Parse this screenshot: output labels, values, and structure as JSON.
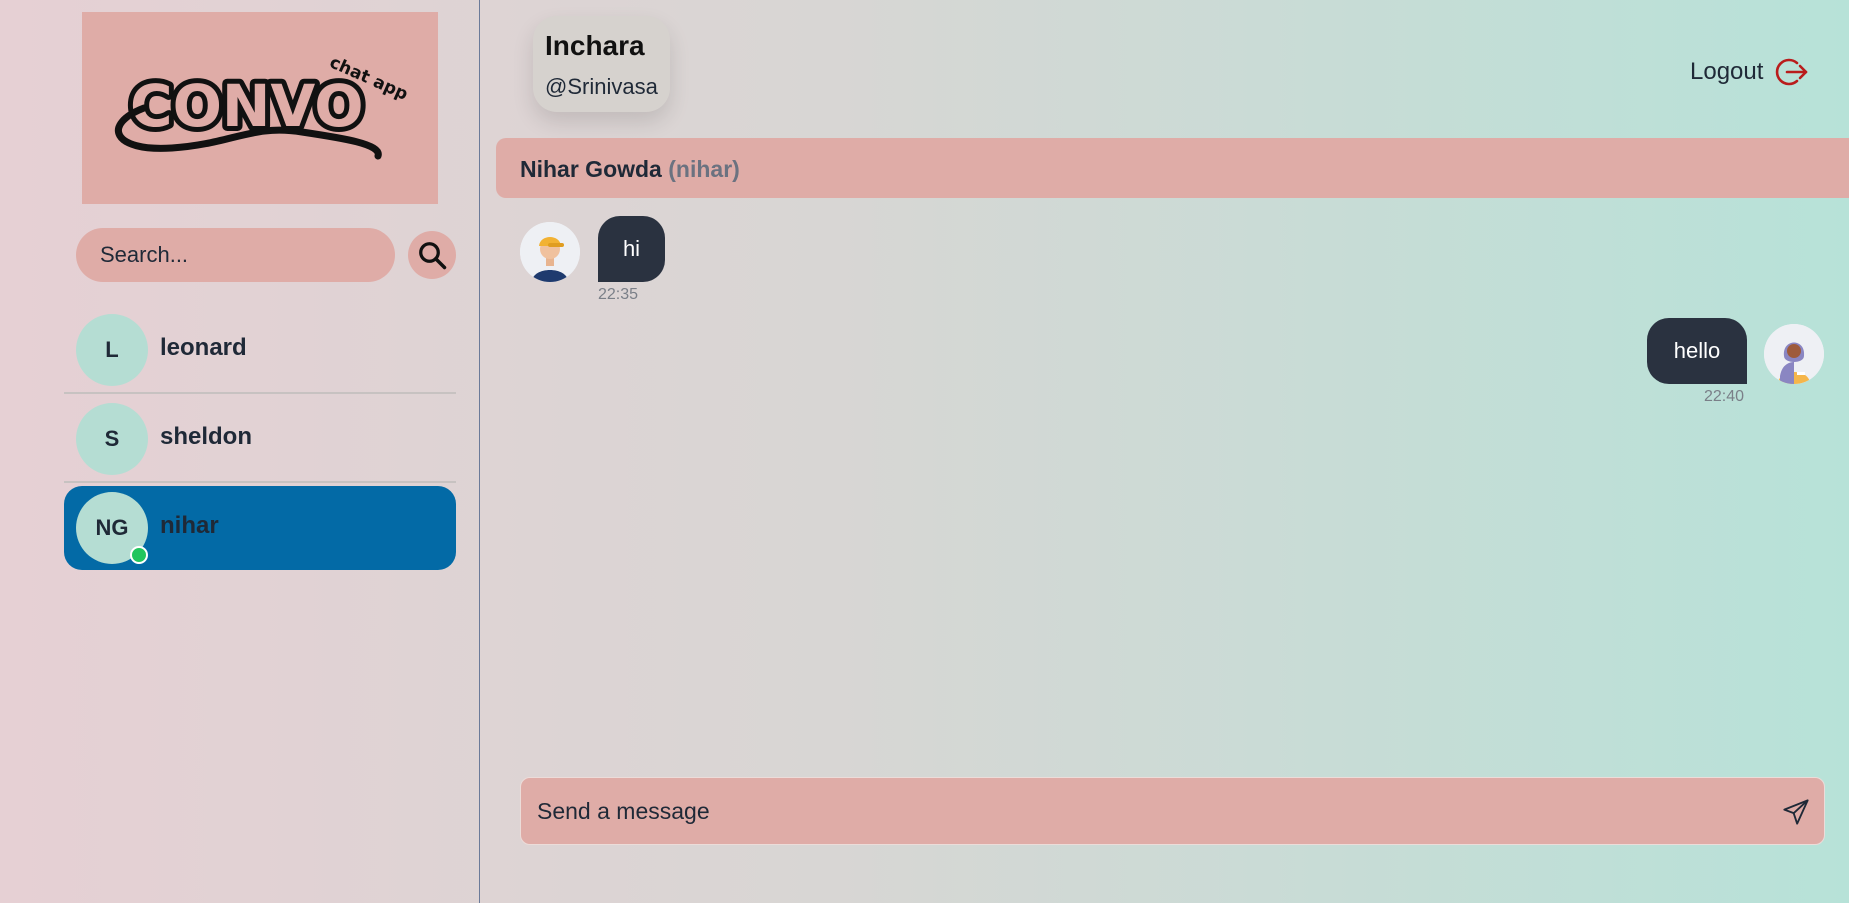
{
  "logo": {
    "wordmark": "CONVO",
    "tagline": "chat app"
  },
  "search": {
    "placeholder": "Search...",
    "button_icon": "search-icon"
  },
  "contacts": [
    {
      "initials": "L",
      "name": "leonard",
      "active": false,
      "online": false
    },
    {
      "initials": "S",
      "name": "sheldon",
      "active": false,
      "online": false
    },
    {
      "initials": "NG",
      "name": "nihar",
      "active": true,
      "online": true
    }
  ],
  "current_user": {
    "name": "Inchara",
    "handle": "@Srinivasa"
  },
  "logout": {
    "label": "Logout",
    "icon": "logout-icon"
  },
  "chat": {
    "header": {
      "full_name": "Nihar Gowda",
      "username": "(nihar)"
    },
    "messages": [
      {
        "text": "hi",
        "time": "22:35",
        "from": "other"
      },
      {
        "text": "hello",
        "time": "22:40",
        "from": "me"
      }
    ]
  },
  "composer": {
    "placeholder": "Send a message",
    "send_icon": "send-icon"
  },
  "colors": {
    "accent_pink": "#dfaca7",
    "active_blue": "#036aa6",
    "bubble_dark": "#2a3240",
    "avatar_mint": "#b5ddd3",
    "online_green": "#22c55e",
    "logout_red": "#b91c1c"
  }
}
